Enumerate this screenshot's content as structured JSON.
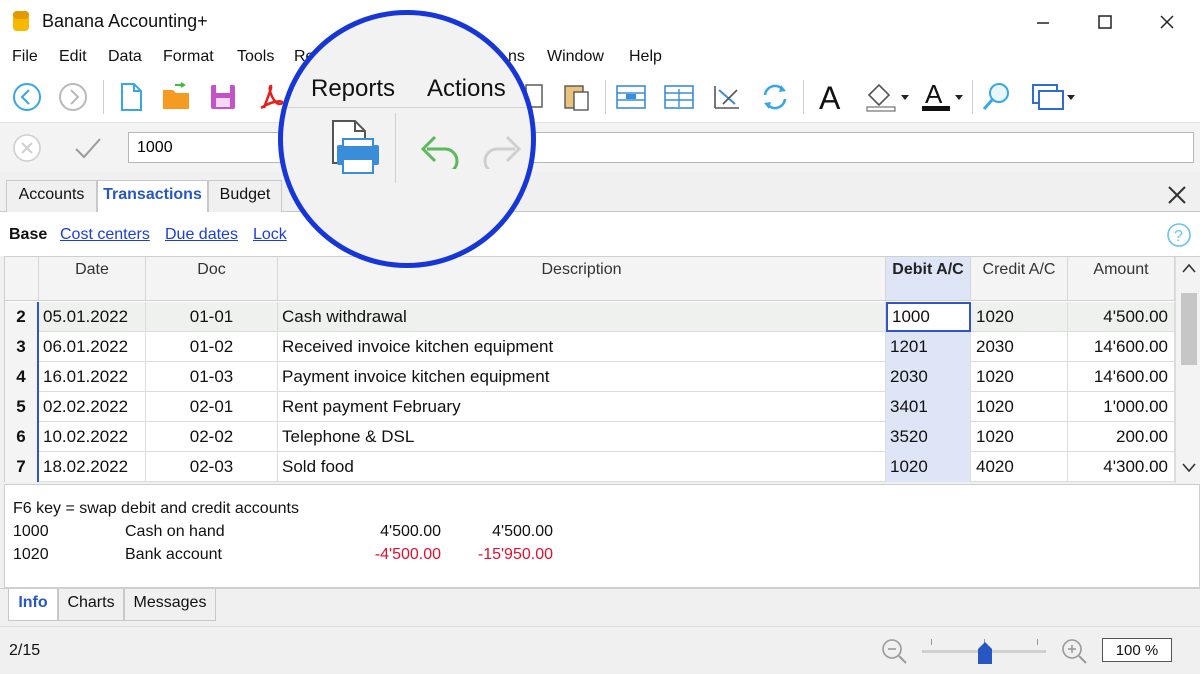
{
  "window": {
    "title": "Banana Accounting+"
  },
  "menu": [
    "File",
    "Edit",
    "Data",
    "Format",
    "Tools",
    "Re",
    "ns",
    "Window",
    "Help"
  ],
  "toolbar": {
    "icons": [
      "back-icon",
      "forward-icon",
      "new-file-icon",
      "open-folder-icon",
      "save-icon",
      "pdf-icon",
      "copy-icon",
      "paste-icon",
      "insert-rows-icon",
      "delete-rows-icon",
      "sort-icon",
      "recheck-icon",
      "font-icon",
      "fill-color-icon",
      "text-color-icon",
      "find-icon",
      "window-icon"
    ]
  },
  "editbar": {
    "value": "1000"
  },
  "tabs": [
    "Accounts",
    "Transactions",
    "Budget"
  ],
  "active_tab": "Transactions",
  "views": {
    "base": "Base",
    "links": [
      "Cost centers",
      "Due dates",
      "Lock"
    ]
  },
  "table": {
    "columns": [
      "Date",
      "Doc",
      "Description",
      "Debit A/C",
      "Credit A/C",
      "Amount"
    ],
    "rows": [
      {
        "n": "2",
        "date": "05.01.2022",
        "doc": "01-01",
        "desc": "Cash withdrawal",
        "debit": "1000",
        "credit": "1020",
        "amount": "4'500.00"
      },
      {
        "n": "3",
        "date": "06.01.2022",
        "doc": "01-02",
        "desc": "Received invoice kitchen equipment",
        "debit": "1201",
        "credit": "2030",
        "amount": "14'600.00"
      },
      {
        "n": "4",
        "date": "16.01.2022",
        "doc": "01-03",
        "desc": "Payment invoice kitchen equipment",
        "debit": "2030",
        "credit": "1020",
        "amount": "14'600.00"
      },
      {
        "n": "5",
        "date": "02.02.2022",
        "doc": "02-01",
        "desc": "Rent payment February",
        "debit": "3401",
        "credit": "1020",
        "amount": "1'000.00"
      },
      {
        "n": "6",
        "date": "10.02.2022",
        "doc": "02-02",
        "desc": "Telephone & DSL",
        "debit": "3520",
        "credit": "1020",
        "amount": "200.00"
      },
      {
        "n": "7",
        "date": "18.02.2022",
        "doc": "02-03",
        "desc": "Sold food",
        "debit": "1020",
        "credit": "4020",
        "amount": "4'300.00"
      }
    ]
  },
  "info": {
    "hint": "F6 key = swap debit and credit accounts",
    "lines": [
      {
        "account": "1000",
        "name": "Cash on hand",
        "v1": "4'500.00",
        "v2": "4'500.00",
        "negative": false
      },
      {
        "account": "1020",
        "name": "Bank account",
        "v1": "-4'500.00",
        "v2": "-15'950.00",
        "negative": true
      }
    ]
  },
  "bottom_tabs": [
    "Info",
    "Charts",
    "Messages"
  ],
  "status": {
    "position": "2/15",
    "zoom": "100 %"
  },
  "callout": {
    "reports": "Reports",
    "actions": "Actions"
  },
  "colors": {
    "accent": "#2657c2",
    "callout_ring": "#1736d8",
    "negative": "#e0102f",
    "debit_column": "#dde5f6"
  }
}
